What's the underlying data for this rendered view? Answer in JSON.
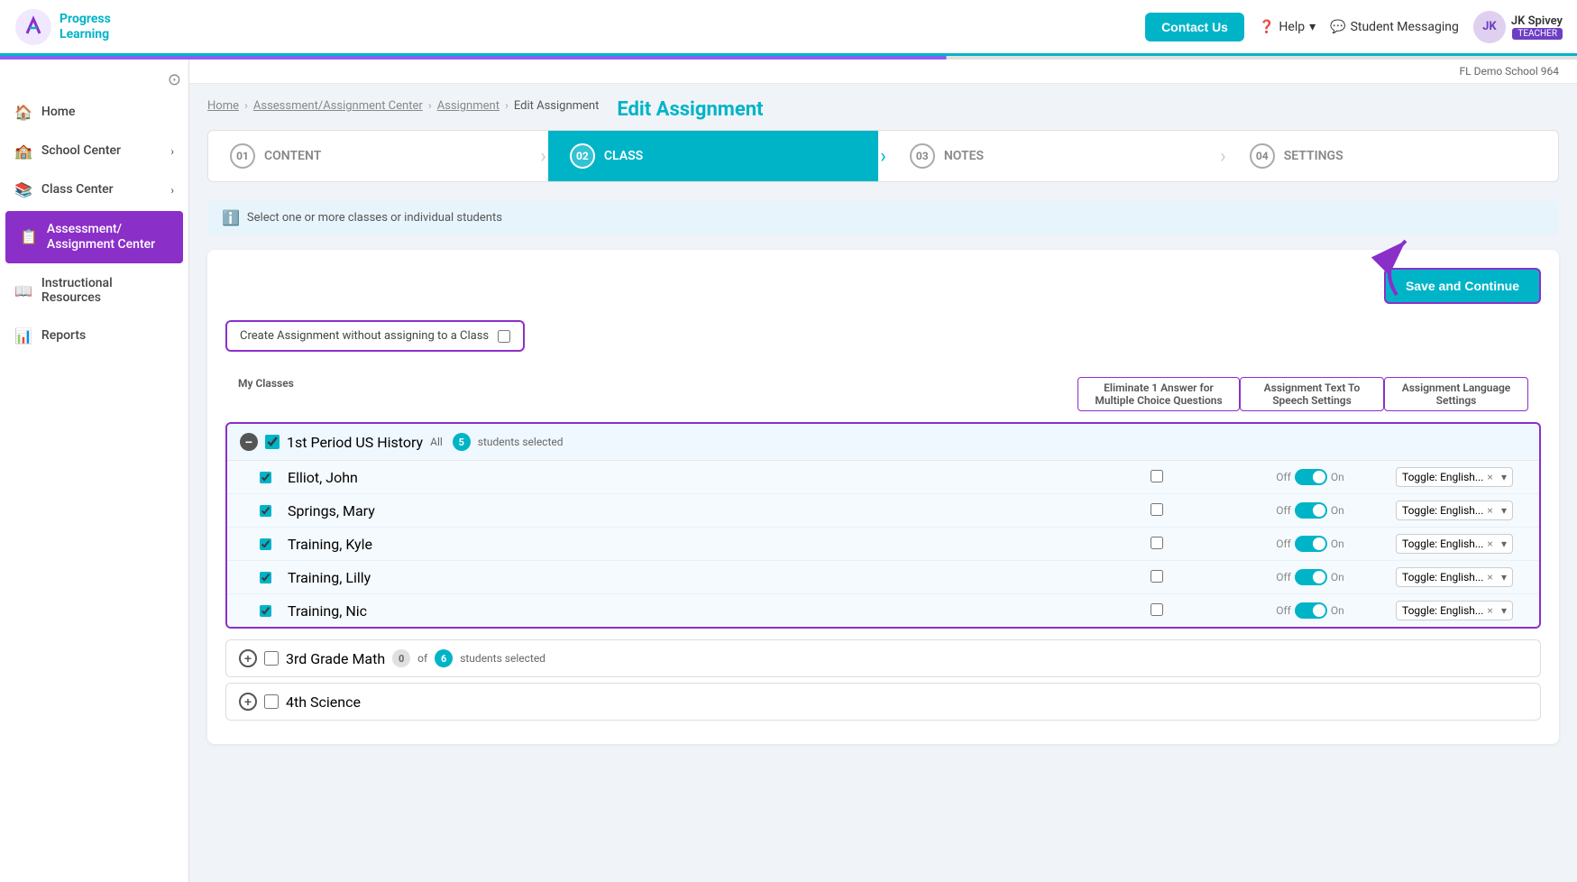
{
  "header": {
    "logo_line1": "Progress",
    "logo_line2": "Learning",
    "contact_label": "Contact Us",
    "help_label": "Help",
    "messaging_label": "Student Messaging",
    "user_name": "JK Spivey",
    "user_role": "TEACHER"
  },
  "school_bar": {
    "label": "FL Demo School 964"
  },
  "sidebar": {
    "items": [
      {
        "id": "home",
        "label": "Home",
        "icon": "🏠",
        "has_chevron": false
      },
      {
        "id": "school-center",
        "label": "School Center",
        "icon": "🏫",
        "has_chevron": true
      },
      {
        "id": "class-center",
        "label": "Class Center",
        "icon": "📚",
        "has_chevron": true
      },
      {
        "id": "assessment",
        "label": "Assessment/ Assignment Center",
        "icon": "📋",
        "has_chevron": false,
        "active": true
      },
      {
        "id": "instructional",
        "label": "Instructional Resources",
        "icon": "📖",
        "has_chevron": false
      },
      {
        "id": "reports",
        "label": "Reports",
        "icon": "📊",
        "has_chevron": false
      }
    ]
  },
  "breadcrumb": {
    "items": [
      "Home",
      "Assessment/Assignment Center",
      "Assignment",
      "Edit Assignment"
    ]
  },
  "page_title": "Edit Assignment",
  "steps": [
    {
      "num": "01",
      "label": "CONTENT",
      "active": false
    },
    {
      "num": "02",
      "label": "CLASS",
      "active": true
    },
    {
      "num": "03",
      "label": "NOTES",
      "active": false
    },
    {
      "num": "04",
      "label": "SETTINGS",
      "active": false
    }
  ],
  "info_message": "Select one or more classes or individual students",
  "save_button_label": "Save and Continue",
  "create_assignment_label": "Create Assignment without assigning to a Class",
  "table_headers": {
    "my_classes": "My Classes",
    "eliminate": "Eliminate 1 Answer for Multiple Choice Questions",
    "speech": "Assignment Text To Speech Settings",
    "language": "Assignment Language Settings"
  },
  "classes": [
    {
      "id": "1st-period",
      "name": "1st Period US History",
      "selected_count": 5,
      "total_count": null,
      "is_expanded": true,
      "is_checked": true,
      "status": "active",
      "students": [
        {
          "name": "Elliot, John",
          "checked": true
        },
        {
          "name": "Springs, Mary",
          "checked": true
        },
        {
          "name": "Training, Kyle",
          "checked": true
        },
        {
          "name": "Training, Lilly",
          "checked": true
        },
        {
          "name": "Training, Nic",
          "checked": true
        }
      ]
    },
    {
      "id": "3rd-grade",
      "name": "3rd Grade Math",
      "selected_count": 0,
      "total_count": 6,
      "is_expanded": false,
      "is_checked": false,
      "status": "inactive"
    },
    {
      "id": "4th-science",
      "name": "4th Science",
      "selected_count": null,
      "total_count": null,
      "is_expanded": false,
      "is_checked": false,
      "status": "inactive"
    }
  ],
  "toggle_off": "Off",
  "toggle_on": "On",
  "lang_value": "Toggle: English...",
  "students_selected_label": "students selected",
  "of_label": "of"
}
